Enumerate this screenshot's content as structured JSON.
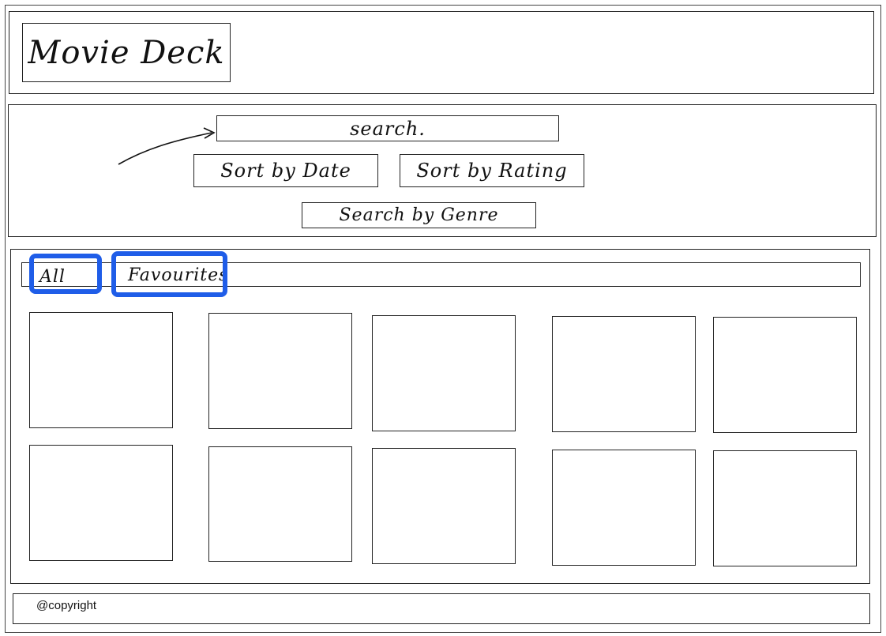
{
  "header": {
    "title": "Movie Deck"
  },
  "controls": {
    "search_label": "search.",
    "sort_by_date": "Sort by Date",
    "sort_by_rating": "Sort by Rating",
    "search_by_genre": "Search by Genre"
  },
  "tabs": [
    {
      "label": "All"
    },
    {
      "label": "Favourites"
    }
  ],
  "cards": {
    "count": 10
  },
  "footer": {
    "copyright": "@copyright"
  },
  "colors": {
    "accent": "#1f5de8",
    "ink": "#222222"
  },
  "icons": {
    "arrow": "arrow-icon"
  }
}
